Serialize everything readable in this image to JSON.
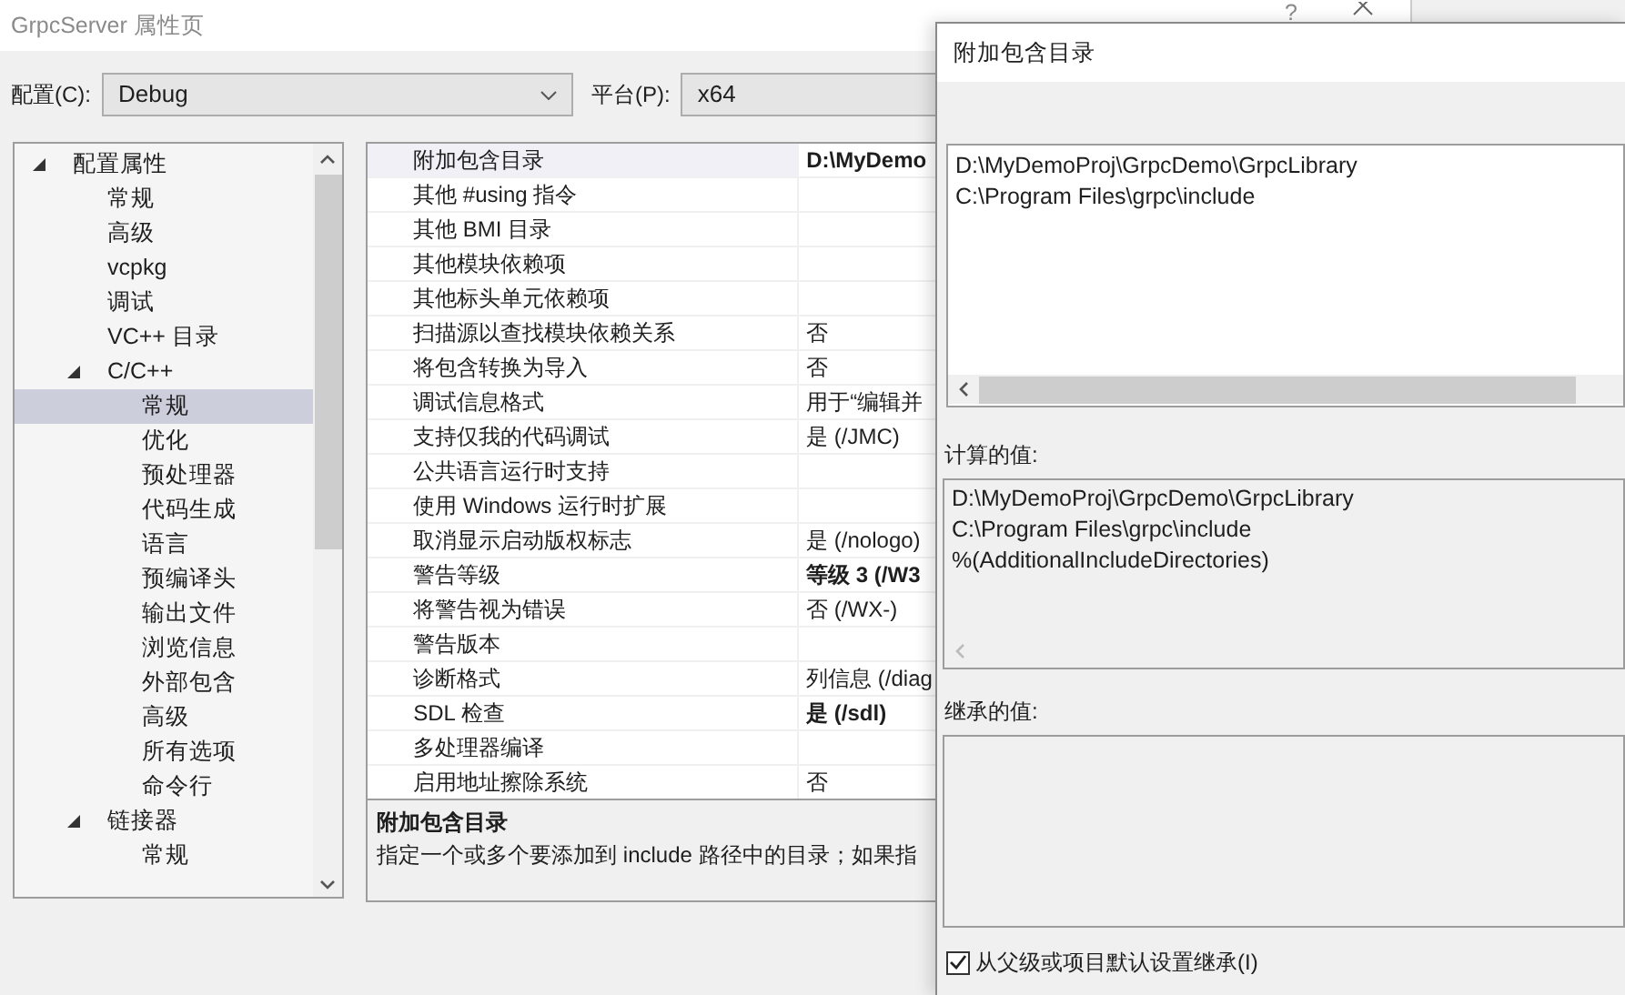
{
  "window": {
    "title": "GrpcServer 属性页",
    "help": "?"
  },
  "configuration": {
    "label": "配置(C):",
    "value": "Debug"
  },
  "platform": {
    "label": "平台(P):",
    "value": "x64"
  },
  "tree": [
    {
      "label": "配置属性",
      "expanded": true,
      "selected": false,
      "children": [
        {
          "label": "常规",
          "selected": false
        },
        {
          "label": "高级",
          "selected": false
        },
        {
          "label": "vcpkg",
          "selected": false
        },
        {
          "label": "调试",
          "selected": false
        },
        {
          "label": "VC++ 目录",
          "selected": false
        },
        {
          "label": "C/C++",
          "expanded": true,
          "selected": false,
          "children": [
            {
              "label": "常规",
              "selected": true
            },
            {
              "label": "优化",
              "selected": false
            },
            {
              "label": "预处理器",
              "selected": false
            },
            {
              "label": "代码生成",
              "selected": false
            },
            {
              "label": "语言",
              "selected": false
            },
            {
              "label": "预编译头",
              "selected": false
            },
            {
              "label": "输出文件",
              "selected": false
            },
            {
              "label": "浏览信息",
              "selected": false
            },
            {
              "label": "外部包含",
              "selected": false
            },
            {
              "label": "高级",
              "selected": false
            },
            {
              "label": "所有选项",
              "selected": false
            },
            {
              "label": "命令行",
              "selected": false
            }
          ]
        },
        {
          "label": "链接器",
          "expanded": true,
          "selected": false,
          "children": [
            {
              "label": "常规",
              "selected": false
            }
          ]
        }
      ]
    }
  ],
  "properties": [
    {
      "name": "附加包含目录",
      "value": "D:\\MyDemo",
      "bold": true,
      "selected": true
    },
    {
      "name": "其他 #using 指令",
      "selected": false
    },
    {
      "name": "其他 BMI 目录",
      "selected": false
    },
    {
      "name": "其他模块依赖项",
      "selected": false
    },
    {
      "name": "其他标头单元依赖项",
      "selected": false
    },
    {
      "name": "扫描源以查找模块依赖关系",
      "value": "否",
      "bold": false,
      "selected": false
    },
    {
      "name": "将包含转换为导入",
      "value": "否",
      "bold": false,
      "selected": false
    },
    {
      "name": "调试信息格式",
      "value": "用于“编辑并",
      "bold": false,
      "selected": false
    },
    {
      "name": "支持仅我的代码调试",
      "value": "是 (/JMC)",
      "bold": false,
      "selected": false
    },
    {
      "name": "公共语言运行时支持",
      "selected": false
    },
    {
      "name": "使用 Windows 运行时扩展",
      "selected": false
    },
    {
      "name": "取消显示启动版权标志",
      "value": "是 (/nologo)",
      "bold": false,
      "selected": false
    },
    {
      "name": "警告等级",
      "value": "等级 3 (/W3",
      "bold": true,
      "selected": false
    },
    {
      "name": "将警告视为错误",
      "value": "否 (/WX-)",
      "bold": false,
      "selected": false
    },
    {
      "name": "警告版本",
      "selected": false
    },
    {
      "name": "诊断格式",
      "value": "列信息 (/diag",
      "bold": false,
      "selected": false
    },
    {
      "name": "SDL 检查",
      "value": "是 (/sdl)",
      "bold": true,
      "selected": false
    },
    {
      "name": "多处理器编译",
      "selected": false
    },
    {
      "name": "启用地址擦除系统",
      "value": "否",
      "bold": false,
      "selected": false
    }
  ],
  "description": {
    "title": "附加包含目录",
    "text": "指定一个或多个要添加到 include 路径中的目录；如果指"
  },
  "dialog": {
    "title": "附加包含目录",
    "lines": [
      "D:\\MyDemoProj\\GrpcDemo\\GrpcLibrary",
      "C:\\Program Files\\grpc\\include"
    ],
    "computed_label": "计算的值:",
    "computed_lines": [
      "D:\\MyDemoProj\\GrpcDemo\\GrpcLibrary",
      "C:\\Program Files\\grpc\\include",
      "%(AdditionalIncludeDirectories)"
    ],
    "inherited_label": "继承的值:",
    "inherit": {
      "label": "从父级或项目默认设置继承(I)",
      "checked": true
    }
  }
}
